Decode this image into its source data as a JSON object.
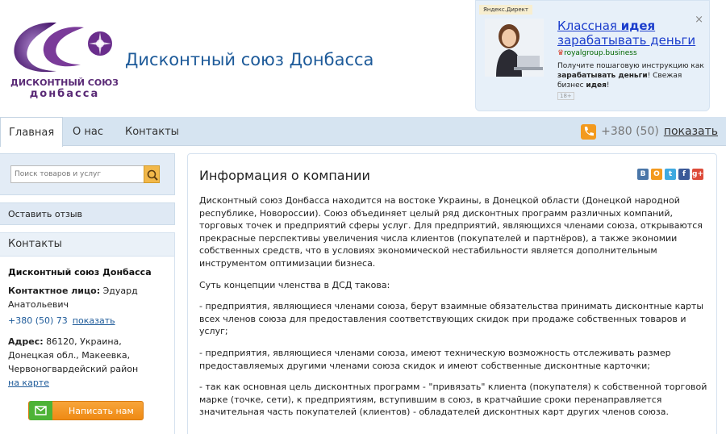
{
  "site": {
    "title": "Дисконтный союз Донбасса",
    "logo_text_line1": "ДИСКОНТНЫЙ СОЮЗ",
    "logo_text_line2": "донбасса"
  },
  "ad": {
    "label": "Яндекс.Директ",
    "headline_part1": "Классная ",
    "headline_bold": "идея",
    "headline_part2": "зарабатывать деньги",
    "domain": "royalgroup.business",
    "text_part1": "Получите пошаговую инструкцию как ",
    "text_bold1": "зарабатывать деньги",
    "text_part2": "! Свежая бизнес ",
    "text_bold2": "идея",
    "text_part3": "!",
    "age": "18+",
    "close": "×"
  },
  "nav": {
    "tabs": [
      "Главная",
      "О нас",
      "Контакты"
    ],
    "phone": "+380 (50)",
    "phone_show": "показать"
  },
  "sidebar": {
    "search_placeholder": "Поиск товаров и услуг",
    "review_label": "Оставить отзыв",
    "contacts_title": "Контакты",
    "company_name": "Дисконтный союз Донбасса",
    "person_label": "Контактное лицо:",
    "person_name": " Эдуард Анатольевич",
    "phone": "+380 (50) 73",
    "phone_show": "показать",
    "address_label": "Адрес:",
    "address": " 86120, Украина, Донецкая обл., Макеевка, Червоногвардейский район",
    "map_link": "на карте",
    "write_button": "Написать нам"
  },
  "main": {
    "title": "Информация о компании",
    "socials": [
      "В",
      "О",
      "t",
      "f",
      "g+"
    ],
    "social_colors": [
      "#4a76a8",
      "#f39a1e",
      "#3fa9e0",
      "#3b5998",
      "#dd4b39"
    ],
    "paragraphs": [
      "Дисконтный союз Донбасса находится на востоке Украины, в Донецкой области (Донецкой народной республике, Новороссии). Союз объединяет целый ряд дисконтных программ различных компаний, торговых точек и предприятий сферы услуг. Для предприятий, являющихся членами союза, открываются прекрасные перспективы увеличения числа клиентов (покупателей и партнёров), а также экономии собственных средств, что в условиях экономической нестабильности является дополнительным инструментом оптимизации бизнеса.",
      "Суть концепции членства в ДСД такова:",
      "- предприятия, являющиеся членами союза, берут взаимные обязательства принимать дисконтные карты всех членов союза для предоставления соответствующих скидок при продаже собственных товаров и услуг;",
      "- предприятия, являющиеся членами союза, имеют техническую возможность отслеживать размер предоставляемых другими членами союза скидок и имеют собственные дисконтные карточки;",
      "- так как основная цель дисконтных программ - \"привязать\" клиента (покупателя) к собственной торговой марке (точке, сети), к предприятиям, вступившим в союз, в кратчайшие сроки перенаправляется значительная часть покупателей (клиентов) - обладателей дисконтных карт других членов союза."
    ]
  }
}
